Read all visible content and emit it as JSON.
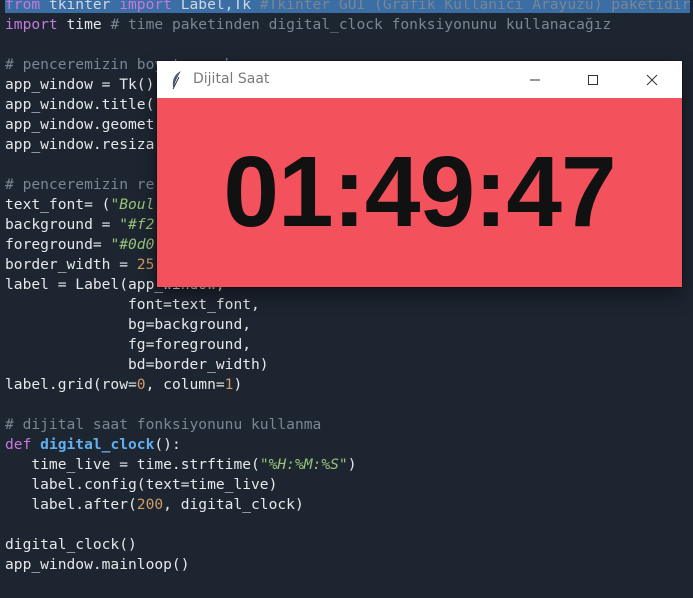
{
  "editor": {
    "lines": [
      [
        {
          "t": "from",
          "c": "kw hl"
        },
        {
          "t": " tkinter ",
          "c": "hl"
        },
        {
          "t": "import",
          "c": "kw hl"
        },
        {
          "t": " Label,Tk ",
          "c": "hl"
        },
        {
          "t": "#Tkinter GUI (Grafik Kullanıcı Arayüzü) paketidir",
          "c": "cmt hl"
        }
      ],
      [
        {
          "t": "import",
          "c": "kw"
        },
        {
          "t": " time ",
          "c": ""
        },
        {
          "t": "# time paketinden digital_clock fonksiyonunu kullanacağız",
          "c": "cmt"
        }
      ],
      [],
      [
        {
          "t": "# penceremizin boyutu ve ba",
          "c": "cmt"
        }
      ],
      [
        {
          "t": "app_window = Tk()",
          "c": ""
        }
      ],
      [
        {
          "t": "app_window.title(",
          "c": ""
        }
      ],
      [
        {
          "t": "app_window.geomet",
          "c": ""
        }
      ],
      [
        {
          "t": "app_window.resiza",
          "c": ""
        }
      ],
      [],
      [
        {
          "t": "# penceremizin re",
          "c": "cmt"
        }
      ],
      [
        {
          "t": "text_font= (",
          "c": ""
        },
        {
          "t": "\"Boul",
          "c": "str"
        }
      ],
      [
        {
          "t": "background = ",
          "c": ""
        },
        {
          "t": "\"#f2",
          "c": "str"
        }
      ],
      [
        {
          "t": "foreground= ",
          "c": ""
        },
        {
          "t": "\"#0d0",
          "c": "str"
        }
      ],
      [
        {
          "t": "border_width = ",
          "c": ""
        },
        {
          "t": "25",
          "c": "num"
        }
      ],
      [
        {
          "t": "label = Label(app_window,",
          "c": ""
        }
      ],
      [
        {
          "t": "              font=text_font,",
          "c": ""
        }
      ],
      [
        {
          "t": "              bg=background,",
          "c": ""
        }
      ],
      [
        {
          "t": "              fg=foreground,",
          "c": ""
        }
      ],
      [
        {
          "t": "              bd=border_width)",
          "c": ""
        }
      ],
      [
        {
          "t": "label.grid(row=",
          "c": ""
        },
        {
          "t": "0",
          "c": "num"
        },
        {
          "t": ", column=",
          "c": ""
        },
        {
          "t": "1",
          "c": "num"
        },
        {
          "t": ")",
          "c": ""
        }
      ],
      [],
      [
        {
          "t": "# dijital saat fonksiyonunu kullanma",
          "c": "cmt"
        }
      ],
      [
        {
          "t": "def",
          "c": "kw"
        },
        {
          "t": " ",
          "c": ""
        },
        {
          "t": "digital_clock",
          "c": "fn"
        },
        {
          "t": "():",
          "c": ""
        }
      ],
      [
        {
          "t": "   time_live = time.strftime(",
          "c": ""
        },
        {
          "t": "\"%H:%M:%S\"",
          "c": "str"
        },
        {
          "t": ")",
          "c": ""
        }
      ],
      [
        {
          "t": "   label.config(text=time_live)",
          "c": ""
        }
      ],
      [
        {
          "t": "   label.after(",
          "c": ""
        },
        {
          "t": "200",
          "c": "num"
        },
        {
          "t": ", digital_clock)",
          "c": ""
        }
      ],
      [],
      [
        {
          "t": "digital_clock()",
          "c": ""
        }
      ],
      [
        {
          "t": "app_window.mainloop()",
          "c": ""
        }
      ]
    ]
  },
  "window": {
    "title": "Dijital Saat",
    "clock_text": "01:49:47",
    "icons": {
      "app": "feather-icon",
      "minimize": "minimize-icon",
      "maximize": "maximize-icon",
      "close": "close-icon"
    },
    "colors": {
      "background": "#f3515b",
      "foreground": "#111111"
    }
  }
}
